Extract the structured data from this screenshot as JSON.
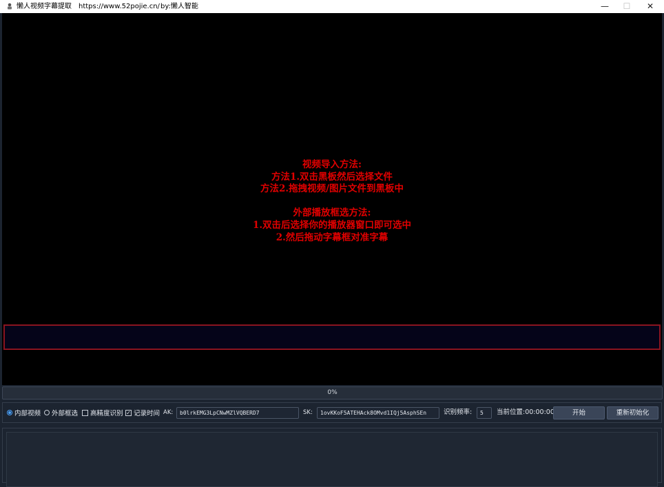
{
  "window": {
    "title": "懒人视频字幕提取",
    "url": "https://www.52pojie.cn/",
    "author": "by:懒人智能",
    "minimize_symbol": "—",
    "maximize_symbol": "☐",
    "close_symbol": "✕"
  },
  "board": {
    "instructions": [
      "视频导入方法:",
      "方法1.双击黑板然后选择文件",
      "方法2.拖拽视频/图片文件到黑板中",
      "",
      "外部播放框选方法:",
      "1.双击后选择你的播放器窗口即可选中",
      "2.然后拖动字幕框对准字幕"
    ]
  },
  "progress": {
    "value": 0,
    "label": "0%"
  },
  "controls": {
    "mode_internal": "内部视频",
    "mode_external": "外部框选",
    "high_precision": "高精度识别",
    "record_time": "记录时间",
    "ak_label": "AK:",
    "ak_value": "b0lrkEMG3LpCNwMZlVQBERD7",
    "sk_label": "SK:",
    "sk_value": "1ovKKoF5ATEHAck8OMvd1IQj5AsphSEn",
    "freq_label": "识别频率:",
    "freq_value": "5",
    "position_label": "当前位置:00:00:00",
    "start_button": "开始",
    "reinit_button": "重新初始化",
    "checkmark": "✓"
  },
  "colors": {
    "instruction_text": "#e00000",
    "subtitle_border": "#8b1420",
    "accent": "#4aa3ff"
  }
}
